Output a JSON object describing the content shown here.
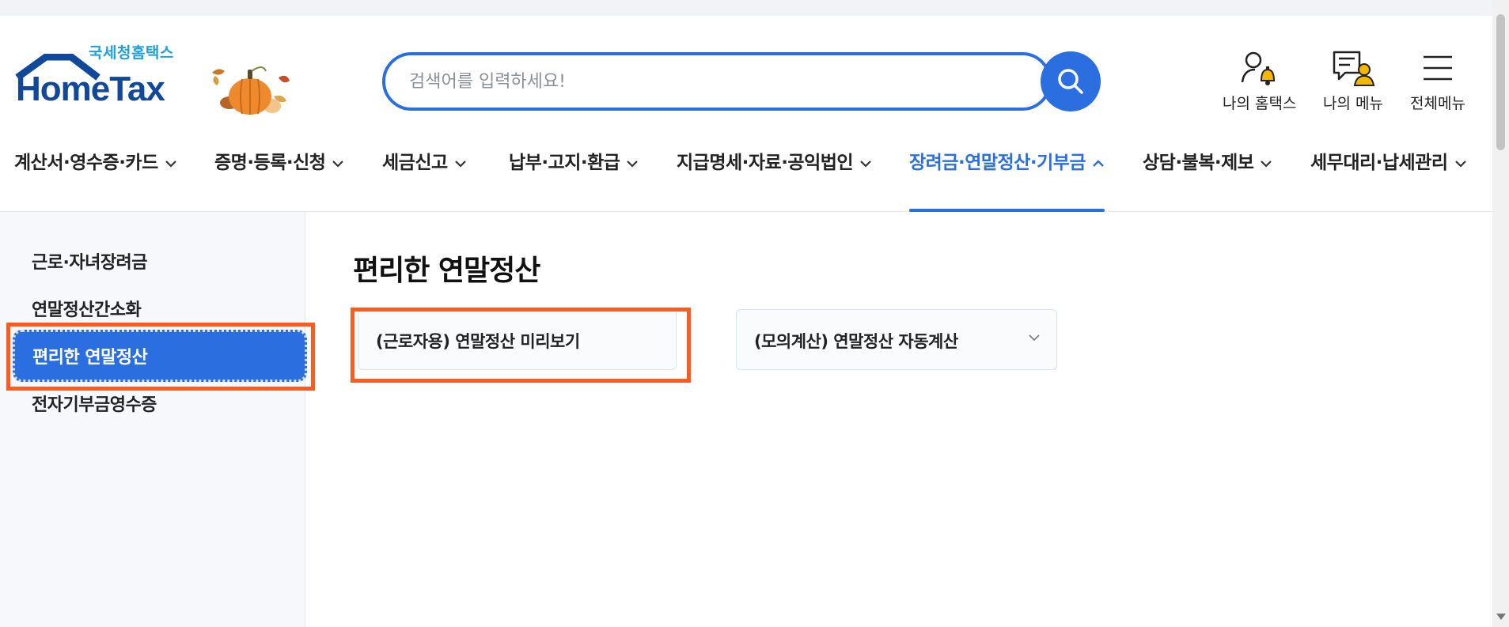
{
  "header": {
    "logo_sub": "국세청홈택스",
    "logo_main": "HomeTax",
    "search_placeholder": "검색어를 입력하세요!",
    "menus": [
      {
        "label": "나의 홈택스",
        "icon": "user-bell-icon"
      },
      {
        "label": "나의 메뉴",
        "icon": "menu-user-icon"
      },
      {
        "label": "전체메뉴",
        "icon": "hamburger-icon"
      }
    ]
  },
  "gnb": {
    "items": [
      {
        "label": "계산서·영수증·카드"
      },
      {
        "label": "증명·등록·신청"
      },
      {
        "label": "세금신고"
      },
      {
        "label": "납부·고지·환급"
      },
      {
        "label": "지급명세·자료·공익법인"
      },
      {
        "label": "장려금·연말정산·기부금",
        "active": true
      },
      {
        "label": "상담·불복·제보"
      },
      {
        "label": "세무대리·납세관리"
      }
    ]
  },
  "sidebar": {
    "items": [
      {
        "label": "근로·자녀장려금"
      },
      {
        "label": "연말정산간소화"
      },
      {
        "label": "편리한 연말정산",
        "active": true
      },
      {
        "label": "전자기부금영수증"
      }
    ]
  },
  "content": {
    "title": "편리한 연말정산",
    "cards": [
      {
        "label": "(근로자용) 연말정산 미리보기"
      },
      {
        "label": "(모의계산) 연말정산 자동계산"
      }
    ]
  },
  "colors": {
    "primary": "#2a6ee0",
    "highlight": "#ff5a1f",
    "logo_blue": "#12489a",
    "logo_sky": "#1f9fd8"
  }
}
